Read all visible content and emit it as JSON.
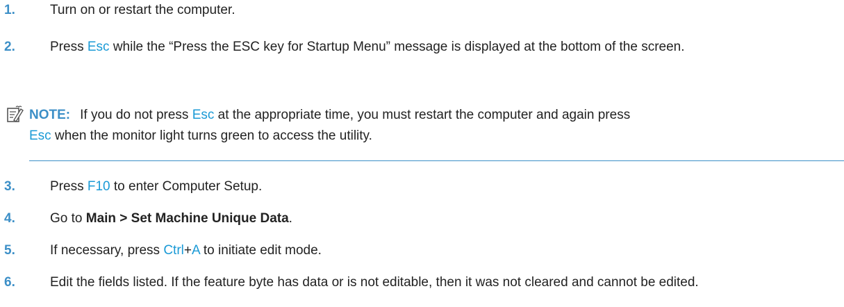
{
  "steps": [
    {
      "number": "1.",
      "text": "Turn on or restart the computer."
    },
    {
      "number": "2.",
      "before": "Press ",
      "key": "Esc",
      "after": " while the “Press the ESC key for Startup Menu” message is displayed at the bottom of the screen."
    },
    {
      "number": "3.",
      "before": "Press ",
      "key": "F10",
      "after": " to enter Computer Setup."
    },
    {
      "number": "4.",
      "before": "Go to ",
      "bold": "Main > Set Machine Unique Data",
      "after": "."
    },
    {
      "number": "5.",
      "before": "If necessary, press ",
      "key1": "Ctrl",
      "plus": "+",
      "key2": "A",
      "after": " to initiate edit mode."
    },
    {
      "number": "6.",
      "text": "Edit the fields listed. If the feature byte has data or is not editable, then it was not cleared and cannot be edited."
    }
  ],
  "note": {
    "icon": "note-icon",
    "label": "NOTE:",
    "before": "If you do not press ",
    "key1": "Esc",
    "middle": " at the appropriate time, you must restart the computer and again press",
    "key2": "Esc",
    "after": " when the monitor light turns green to access the utility."
  },
  "colors": {
    "accent": "#3c8fc7",
    "key": "#1a9ad6",
    "text": "#222222"
  }
}
